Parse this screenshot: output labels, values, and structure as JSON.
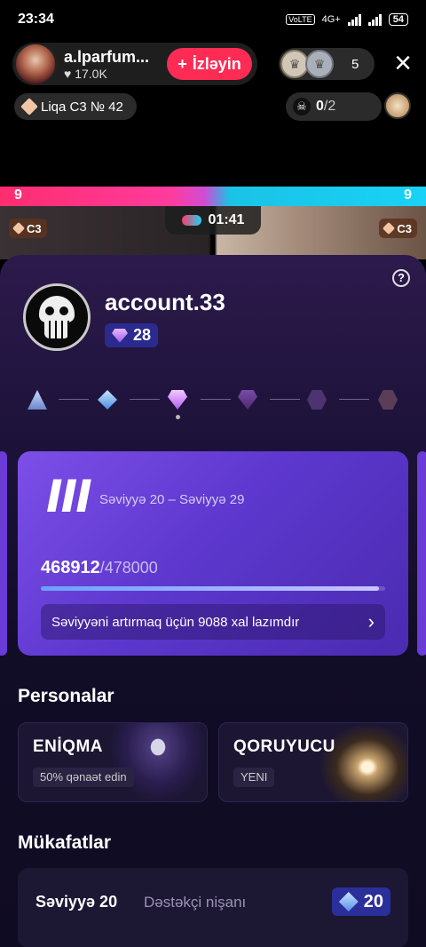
{
  "status_bar": {
    "time": "23:34",
    "volte": "VoLTE",
    "network": "4G+",
    "battery": "54"
  },
  "host": {
    "name": "a.lparfum...",
    "likes": "17.0K",
    "follow_label": "İzləyin",
    "follow_icon": "plus-icon"
  },
  "viewers": {
    "count": "5"
  },
  "league": {
    "label": "Liqa C3 № 42"
  },
  "skull_counter": {
    "value": "0",
    "total": "/2"
  },
  "battle": {
    "left_score": "9",
    "right_score": "9",
    "timer": "01:41",
    "left_badge": "C3",
    "right_badge": "C3"
  },
  "profile": {
    "username": "account.33",
    "level": "28"
  },
  "level_card": {
    "tier_numeral": "III",
    "range": "Səviyyə 20 – Səviyyə 29",
    "points": "468912",
    "points_total": "/478000",
    "progress": 0.981,
    "need_text": "Səviyyəni artırmaq üçün 9088 xal lazımdır"
  },
  "personas": {
    "title": "Personalar",
    "items": [
      {
        "name": "ENİQMA",
        "tag": "50% qənaət edin"
      },
      {
        "name": "QORUYUCU",
        "tag": "YENI"
      }
    ]
  },
  "rewards": {
    "title": "Mükafatlar",
    "item": {
      "level": "Səviyyə 20",
      "name": "Dəstəkçi nişanı",
      "value": "20"
    }
  },
  "colors": {
    "follow": "#fe2c55",
    "card": "#6a44df",
    "sheet": "#1c1238"
  }
}
